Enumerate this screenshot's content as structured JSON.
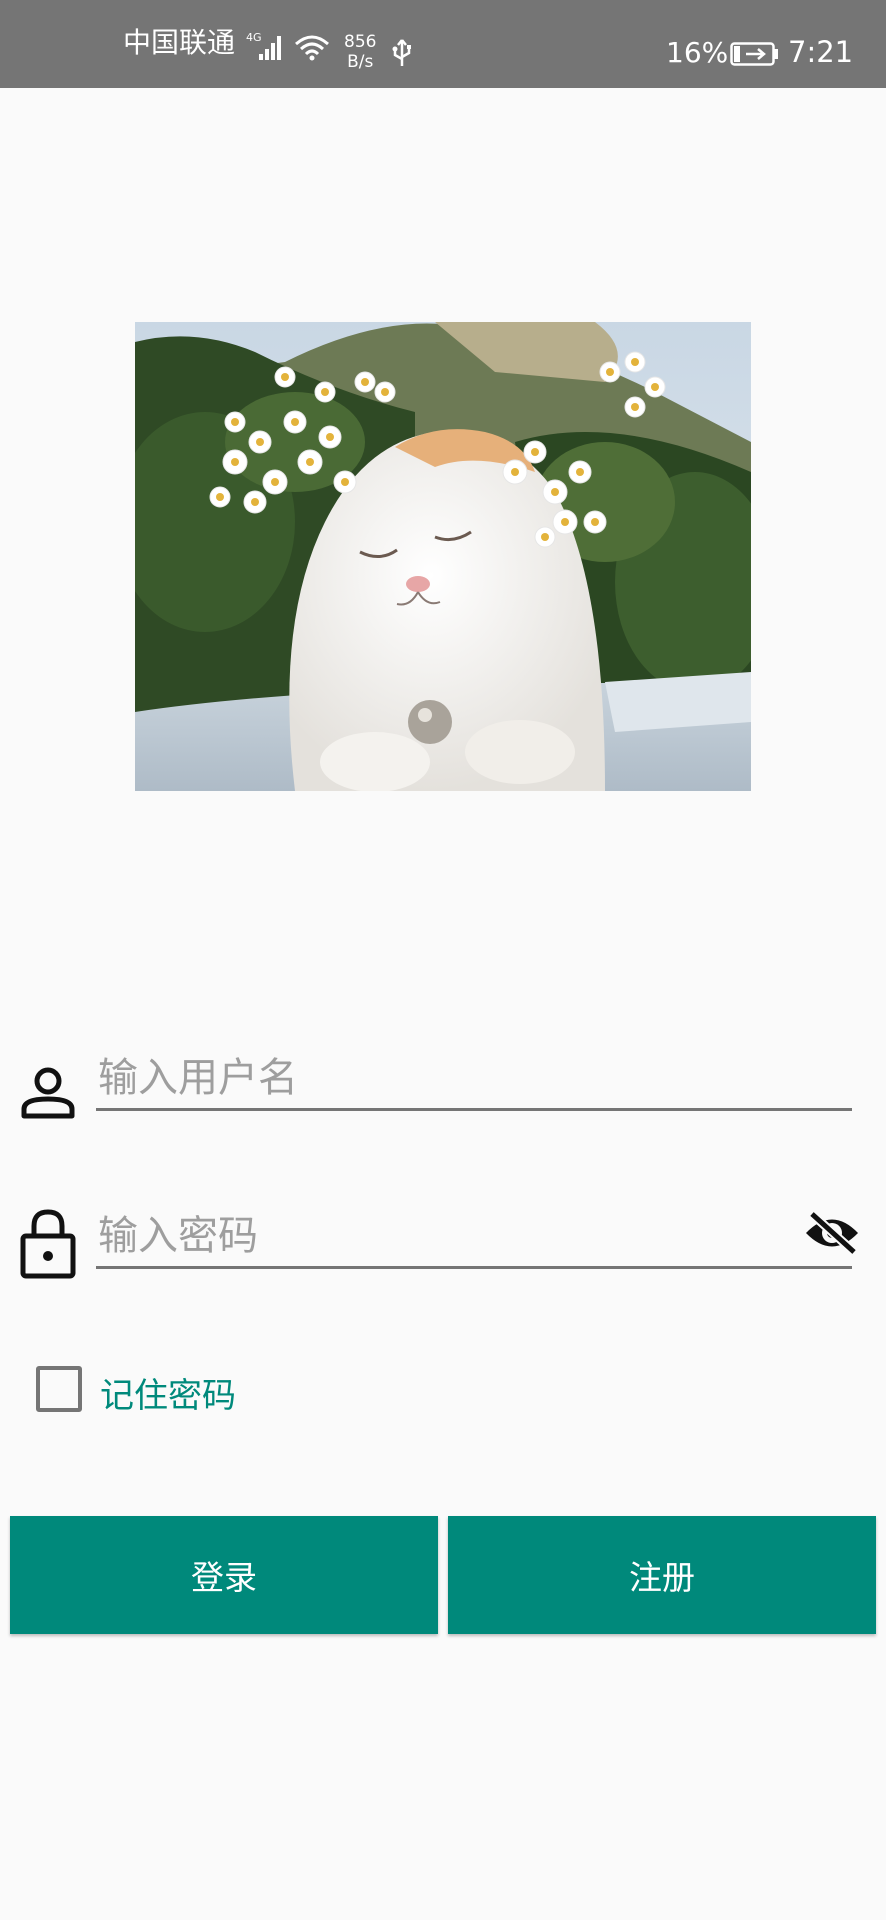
{
  "status_bar": {
    "carrier": "中国联通",
    "network": "4G",
    "speed_value": "856",
    "speed_unit": "B/s",
    "battery": "16%",
    "time": "7:21"
  },
  "login": {
    "username_placeholder": "输入用户名",
    "password_placeholder": "输入密码",
    "remember_label": "记住密码",
    "remember_checked": false,
    "login_button": "登录",
    "register_button": "注册"
  },
  "colors": {
    "status_bar": "#757575",
    "accent": "#00897b",
    "background": "#fafafa"
  },
  "icons": {
    "username": "person-icon",
    "password": "lock-icon",
    "visibility": "eye-off-icon"
  }
}
